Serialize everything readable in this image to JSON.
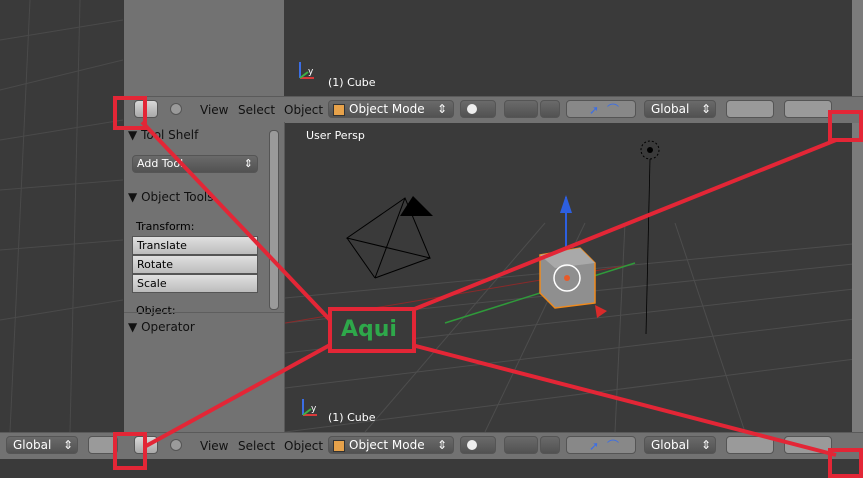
{
  "viewport_top": {
    "object_label": "(1) Cube"
  },
  "viewport_main": {
    "view_label": "User Persp",
    "object_label": "(1) Cube"
  },
  "header": {
    "menu_view": "View",
    "menu_select": "Select",
    "menu_object": "Object",
    "mode": "Object Mode",
    "orientation": "Global"
  },
  "bottom_left_header": {
    "orientation": "Global"
  },
  "tool_shelf": {
    "title": "Tool Shelf",
    "add_tool": "Add Tool",
    "object_tools_title": "Object Tools",
    "transform_label": "Transform:",
    "buttons": [
      "Translate",
      "Rotate",
      "Scale"
    ],
    "object_label": "Object:",
    "operator_title": "Operator"
  },
  "annotation": {
    "text": "Aqui",
    "color": "#2ea84a",
    "line_color": "#e32636"
  }
}
